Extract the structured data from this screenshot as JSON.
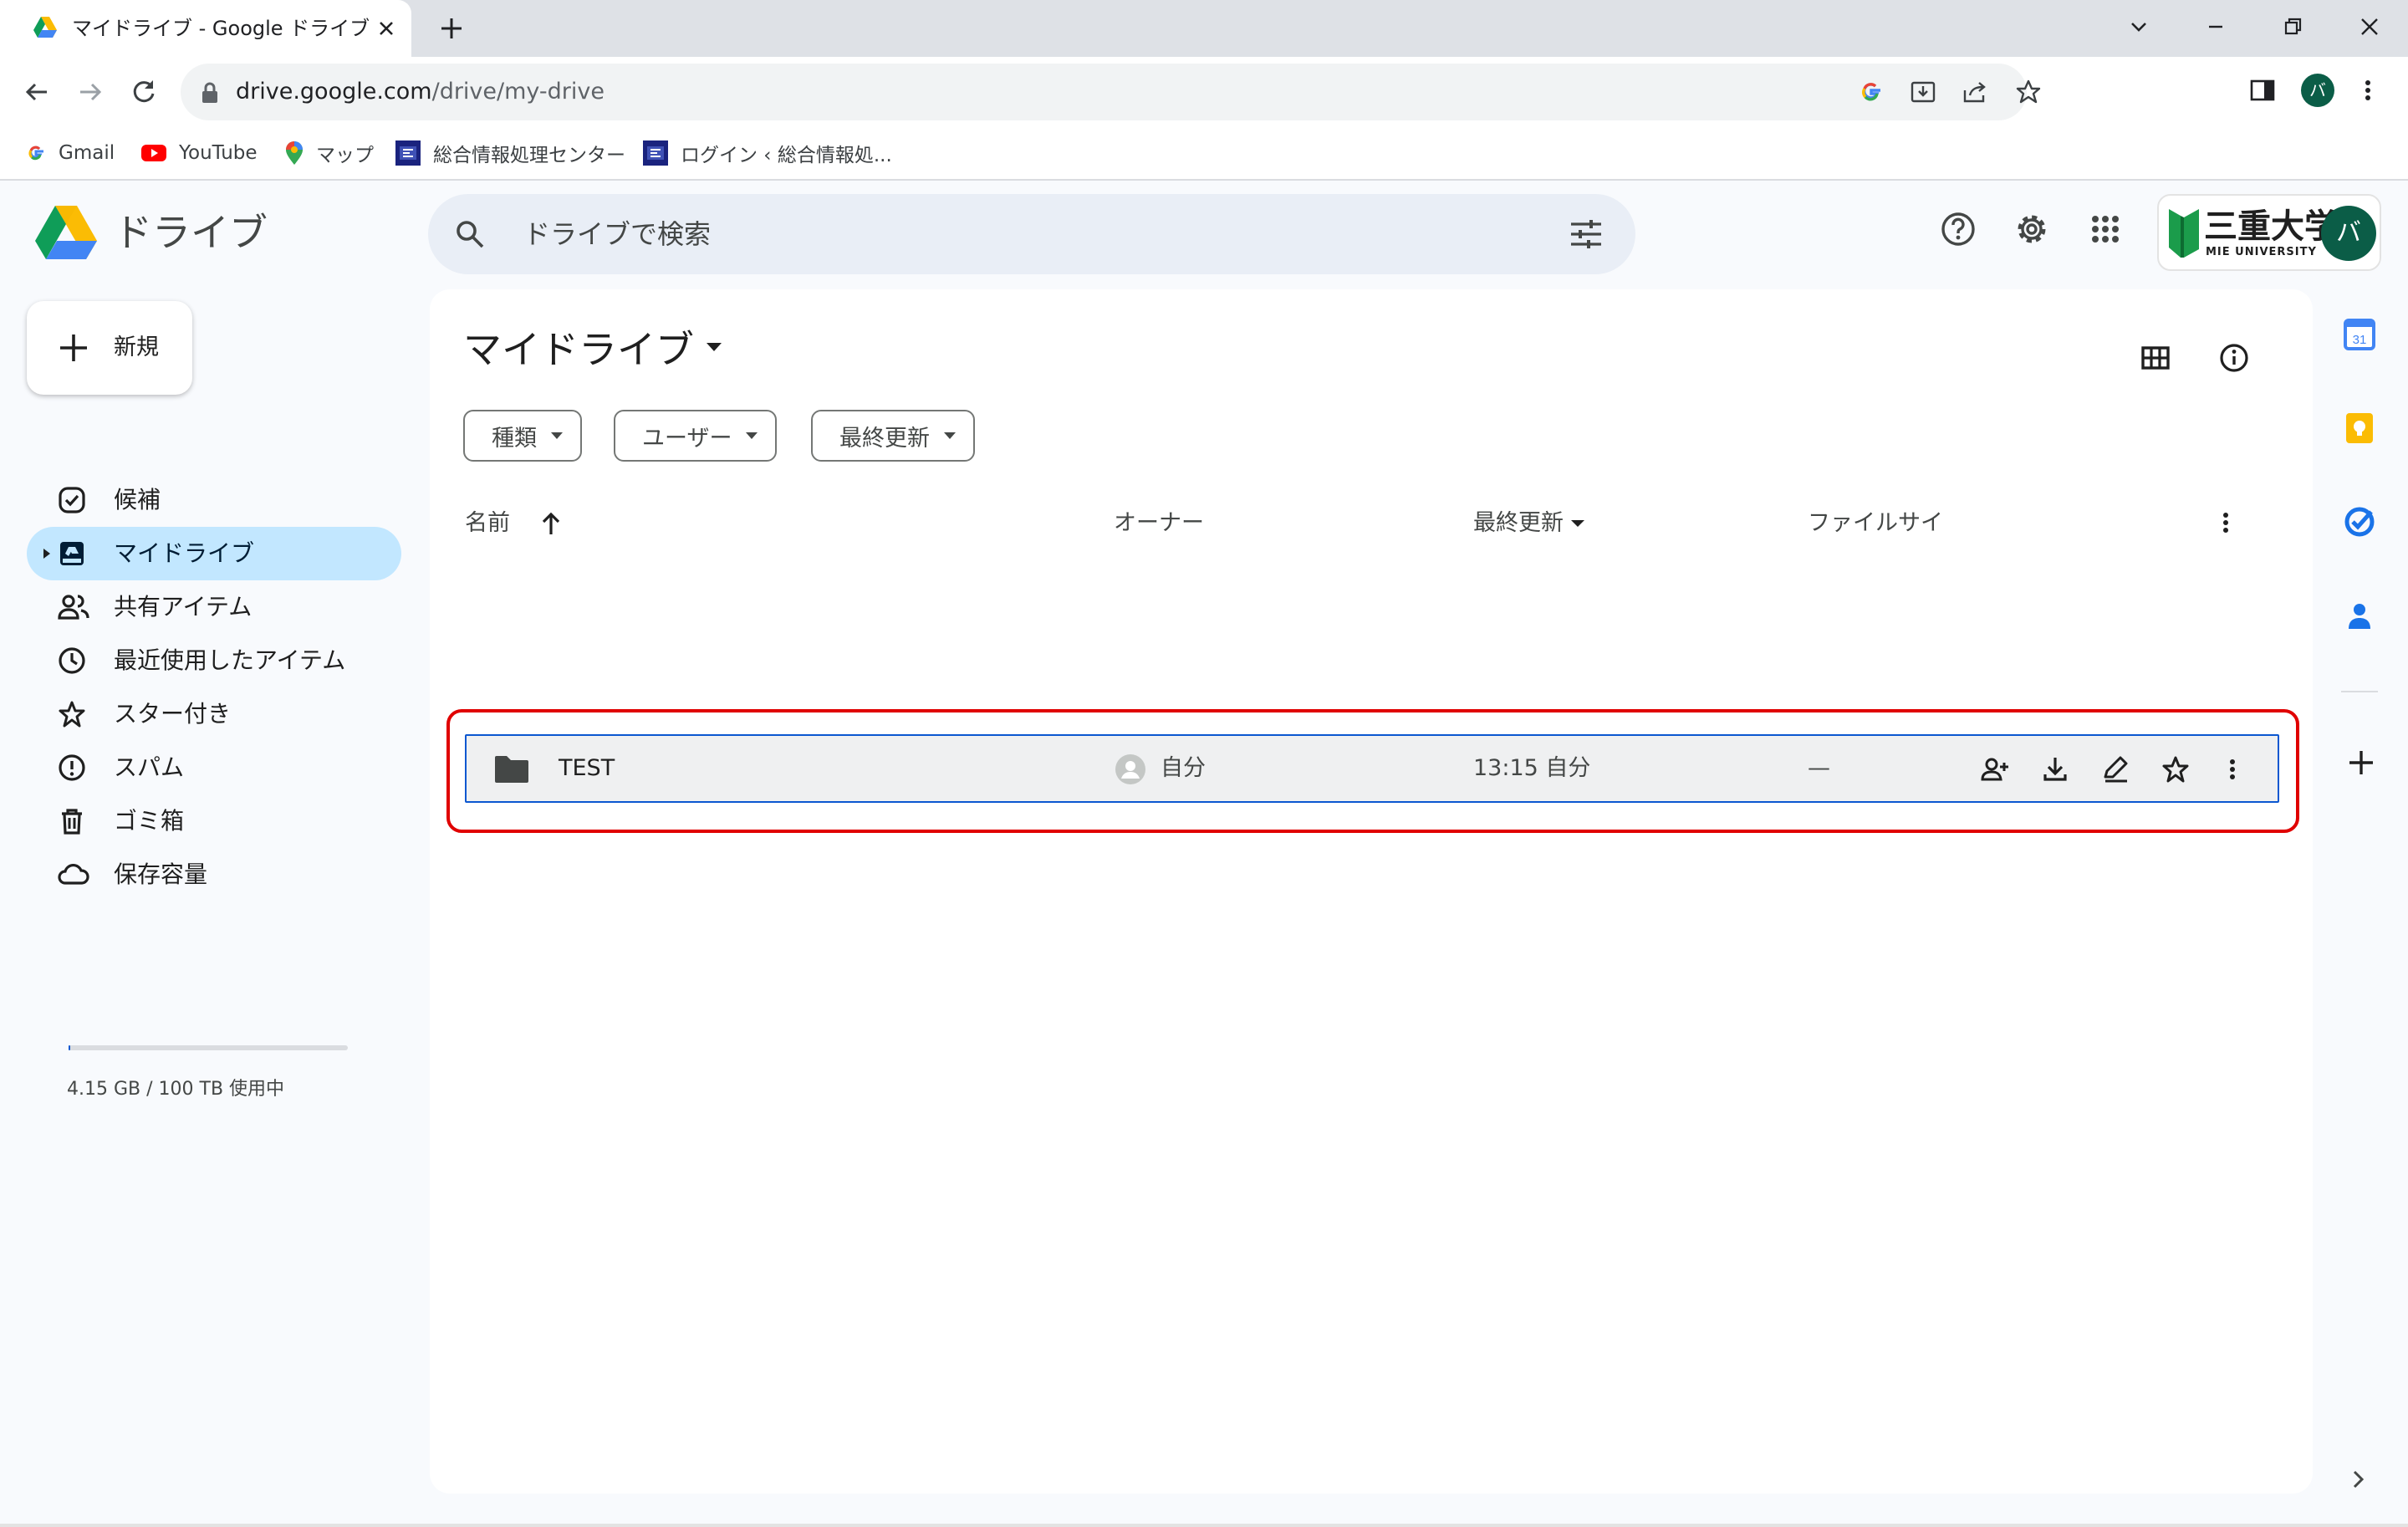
{
  "browser": {
    "tab_title": "マイドライブ - Google ドライブ",
    "url_host": "drive.google.com",
    "url_path": "/drive/my-drive",
    "profile_initial": "バ",
    "bookmarks": [
      {
        "label": "Gmail",
        "icon": "google-icon"
      },
      {
        "label": "YouTube",
        "icon": "youtube-icon"
      },
      {
        "label": "マップ",
        "icon": "maps-icon"
      },
      {
        "label": "総合情報処理センター",
        "icon": "site-icon"
      },
      {
        "label": "ログイン ‹ 総合情報処...",
        "icon": "site-icon"
      }
    ]
  },
  "drive": {
    "app_name": "ドライブ",
    "search_placeholder": "ドライブで検索",
    "new_button": "新規",
    "org": {
      "name": "三重大学",
      "subtitle": "MIE UNIVERSITY"
    },
    "avatar_initial": "バ",
    "nav": [
      {
        "label": "候補",
        "icon": "check-circle-icon"
      },
      {
        "label": "マイドライブ",
        "icon": "my-drive-icon",
        "active": true
      },
      {
        "label": "共有アイテム",
        "icon": "shared-people-icon"
      },
      {
        "label": "最近使用したアイテム",
        "icon": "clock-icon"
      },
      {
        "label": "スター付き",
        "icon": "star-icon"
      },
      {
        "label": "スパム",
        "icon": "spam-icon"
      },
      {
        "label": "ゴミ箱",
        "icon": "trash-icon"
      },
      {
        "label": "保存容量",
        "icon": "cloud-icon"
      }
    ],
    "storage": {
      "text": "4.15 GB / 100 TB 使用中",
      "used_fraction": 4.15e-05
    },
    "page_title": "マイドライブ",
    "filters": [
      "種類",
      "ユーザー",
      "最終更新"
    ],
    "columns": {
      "name": "名前",
      "owner": "オーナー",
      "modified": "最終更新",
      "size": "ファイルサイ"
    },
    "rows": [
      {
        "name": "TEST",
        "type": "folder",
        "owner": "自分",
        "modified": "13:15 自分",
        "size": "—"
      }
    ]
  },
  "colors": {
    "active_nav": "#c2e7ff",
    "accent": "#0b57d0",
    "highlight_box": "#e00000",
    "avatar": "#0b5d47"
  }
}
